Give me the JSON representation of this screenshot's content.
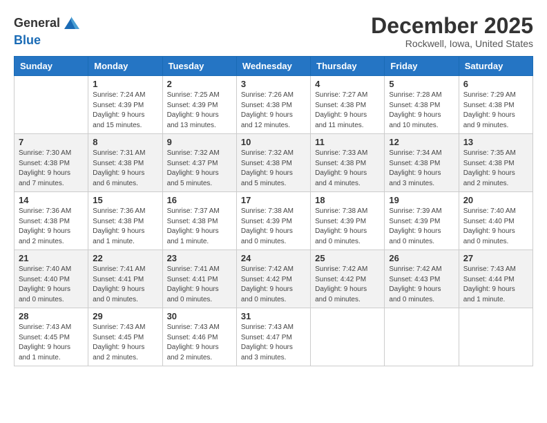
{
  "header": {
    "logo_line1": "General",
    "logo_line2": "Blue",
    "title": "December 2025",
    "subtitle": "Rockwell, Iowa, United States"
  },
  "columns": [
    "Sunday",
    "Monday",
    "Tuesday",
    "Wednesday",
    "Thursday",
    "Friday",
    "Saturday"
  ],
  "weeks": [
    [
      {
        "num": "",
        "info": ""
      },
      {
        "num": "1",
        "info": "Sunrise: 7:24 AM\nSunset: 4:39 PM\nDaylight: 9 hours\nand 15 minutes."
      },
      {
        "num": "2",
        "info": "Sunrise: 7:25 AM\nSunset: 4:39 PM\nDaylight: 9 hours\nand 13 minutes."
      },
      {
        "num": "3",
        "info": "Sunrise: 7:26 AM\nSunset: 4:38 PM\nDaylight: 9 hours\nand 12 minutes."
      },
      {
        "num": "4",
        "info": "Sunrise: 7:27 AM\nSunset: 4:38 PM\nDaylight: 9 hours\nand 11 minutes."
      },
      {
        "num": "5",
        "info": "Sunrise: 7:28 AM\nSunset: 4:38 PM\nDaylight: 9 hours\nand 10 minutes."
      },
      {
        "num": "6",
        "info": "Sunrise: 7:29 AM\nSunset: 4:38 PM\nDaylight: 9 hours\nand 9 minutes."
      }
    ],
    [
      {
        "num": "7",
        "info": "Sunrise: 7:30 AM\nSunset: 4:38 PM\nDaylight: 9 hours\nand 7 minutes."
      },
      {
        "num": "8",
        "info": "Sunrise: 7:31 AM\nSunset: 4:38 PM\nDaylight: 9 hours\nand 6 minutes."
      },
      {
        "num": "9",
        "info": "Sunrise: 7:32 AM\nSunset: 4:37 PM\nDaylight: 9 hours\nand 5 minutes."
      },
      {
        "num": "10",
        "info": "Sunrise: 7:32 AM\nSunset: 4:38 PM\nDaylight: 9 hours\nand 5 minutes."
      },
      {
        "num": "11",
        "info": "Sunrise: 7:33 AM\nSunset: 4:38 PM\nDaylight: 9 hours\nand 4 minutes."
      },
      {
        "num": "12",
        "info": "Sunrise: 7:34 AM\nSunset: 4:38 PM\nDaylight: 9 hours\nand 3 minutes."
      },
      {
        "num": "13",
        "info": "Sunrise: 7:35 AM\nSunset: 4:38 PM\nDaylight: 9 hours\nand 2 minutes."
      }
    ],
    [
      {
        "num": "14",
        "info": "Sunrise: 7:36 AM\nSunset: 4:38 PM\nDaylight: 9 hours\nand 2 minutes."
      },
      {
        "num": "15",
        "info": "Sunrise: 7:36 AM\nSunset: 4:38 PM\nDaylight: 9 hours\nand 1 minute."
      },
      {
        "num": "16",
        "info": "Sunrise: 7:37 AM\nSunset: 4:38 PM\nDaylight: 9 hours\nand 1 minute."
      },
      {
        "num": "17",
        "info": "Sunrise: 7:38 AM\nSunset: 4:39 PM\nDaylight: 9 hours\nand 0 minutes."
      },
      {
        "num": "18",
        "info": "Sunrise: 7:38 AM\nSunset: 4:39 PM\nDaylight: 9 hours\nand 0 minutes."
      },
      {
        "num": "19",
        "info": "Sunrise: 7:39 AM\nSunset: 4:39 PM\nDaylight: 9 hours\nand 0 minutes."
      },
      {
        "num": "20",
        "info": "Sunrise: 7:40 AM\nSunset: 4:40 PM\nDaylight: 9 hours\nand 0 minutes."
      }
    ],
    [
      {
        "num": "21",
        "info": "Sunrise: 7:40 AM\nSunset: 4:40 PM\nDaylight: 9 hours\nand 0 minutes."
      },
      {
        "num": "22",
        "info": "Sunrise: 7:41 AM\nSunset: 4:41 PM\nDaylight: 9 hours\nand 0 minutes."
      },
      {
        "num": "23",
        "info": "Sunrise: 7:41 AM\nSunset: 4:41 PM\nDaylight: 9 hours\nand 0 minutes."
      },
      {
        "num": "24",
        "info": "Sunrise: 7:42 AM\nSunset: 4:42 PM\nDaylight: 9 hours\nand 0 minutes."
      },
      {
        "num": "25",
        "info": "Sunrise: 7:42 AM\nSunset: 4:42 PM\nDaylight: 9 hours\nand 0 minutes."
      },
      {
        "num": "26",
        "info": "Sunrise: 7:42 AM\nSunset: 4:43 PM\nDaylight: 9 hours\nand 0 minutes."
      },
      {
        "num": "27",
        "info": "Sunrise: 7:43 AM\nSunset: 4:44 PM\nDaylight: 9 hours\nand 1 minute."
      }
    ],
    [
      {
        "num": "28",
        "info": "Sunrise: 7:43 AM\nSunset: 4:45 PM\nDaylight: 9 hours\nand 1 minute."
      },
      {
        "num": "29",
        "info": "Sunrise: 7:43 AM\nSunset: 4:45 PM\nDaylight: 9 hours\nand 2 minutes."
      },
      {
        "num": "30",
        "info": "Sunrise: 7:43 AM\nSunset: 4:46 PM\nDaylight: 9 hours\nand 2 minutes."
      },
      {
        "num": "31",
        "info": "Sunrise: 7:43 AM\nSunset: 4:47 PM\nDaylight: 9 hours\nand 3 minutes."
      },
      {
        "num": "",
        "info": ""
      },
      {
        "num": "",
        "info": ""
      },
      {
        "num": "",
        "info": ""
      }
    ]
  ]
}
